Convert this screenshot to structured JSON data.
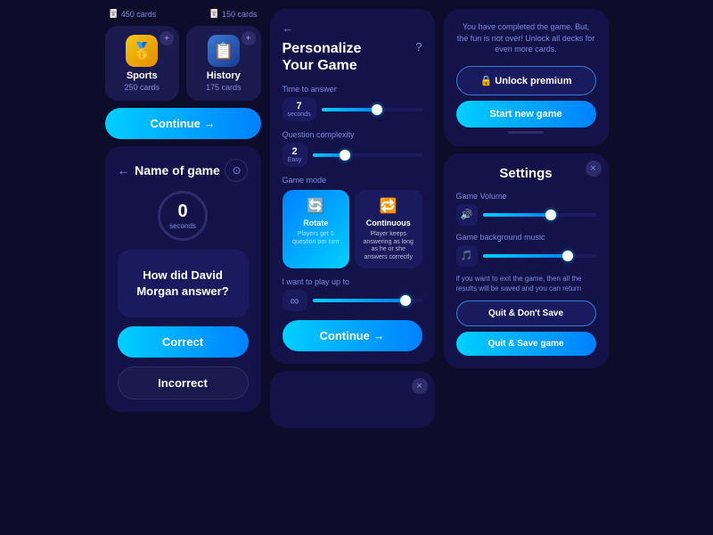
{
  "col1": {
    "cardCountTop": {
      "sports": "450 cards",
      "history": "150 cards"
    },
    "decks": [
      {
        "name": "Sports",
        "count": "250 cards",
        "icon": "🥇",
        "type": "gold"
      },
      {
        "name": "History",
        "count": "175 cards",
        "icon": "📋",
        "type": "blue"
      }
    ],
    "continueLabel": "Continue →",
    "gameName": "Name of game",
    "timerValue": "0",
    "timerUnit": "seconds",
    "question": "How did David Morgan answer?",
    "correctLabel": "Correct",
    "incorrectLabel": "Incorrect"
  },
  "col2": {
    "backLabel": "←",
    "title": "Personalize\nYour Game",
    "helpLabel": "?",
    "timeLabel": "Time to answer",
    "timeValue": "7",
    "timeUnit": "seconds",
    "timeFill": "55",
    "complexityLabel": "Question complexity",
    "complexityValue": "2",
    "complexityUnit": "Easy",
    "complexityFill": "30",
    "gameModeLabel": "Game mode",
    "modes": [
      {
        "name": "Rotate",
        "desc": "Players get 1 question per turn",
        "icon": "🔄",
        "active": true
      },
      {
        "name": "Continuous",
        "desc": "Player keeps answering as long as he or she answers correctly",
        "icon": "🔁",
        "active": false
      }
    ],
    "playUpToLabel": "I want to play up to",
    "playUpToFill": "85",
    "continueLabel": "Continue →",
    "smallPanelX": "×"
  },
  "col3": {
    "completionText": "You have completed the game. But, the fun is not over! Unlock all decks for even more cards.",
    "unlockLabel": "🔒 Unlock premium",
    "startNewGameLabel": "Start new game",
    "settings": {
      "title": "Settings",
      "closeLabel": "×",
      "volumeLabel": "Game Volume",
      "volumeFill": "60",
      "musicLabel": "Game background music",
      "musicFill": "75",
      "exitNote": "if you want to exit the game, then all the results will be saved and you can return",
      "quitLabel": "Quit & Don't Save",
      "quitSaveLabel": "Quit & Save game"
    }
  }
}
